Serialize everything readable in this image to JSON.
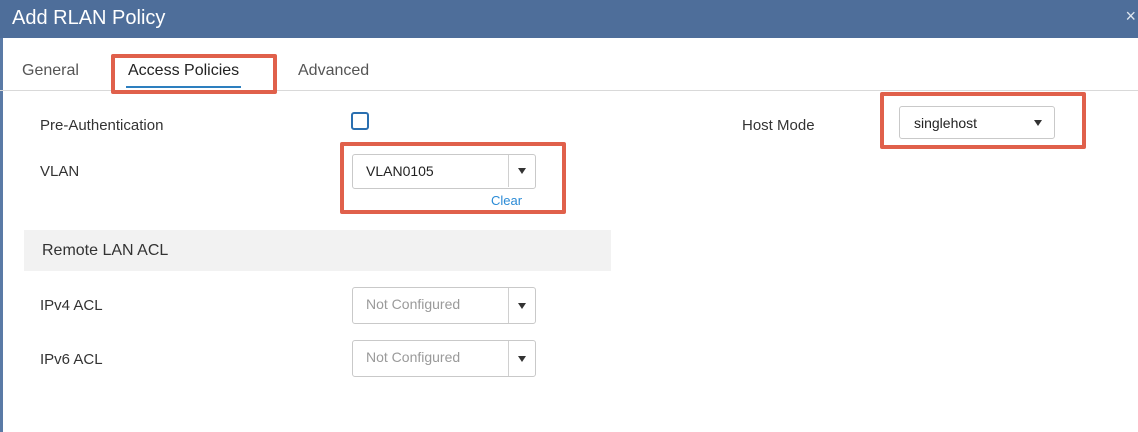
{
  "dialog": {
    "title": "Add RLAN Policy",
    "close_glyph": "×"
  },
  "tabs": [
    {
      "label": "General"
    },
    {
      "label": "Access Policies",
      "active": true
    },
    {
      "label": "Advanced"
    }
  ],
  "form": {
    "pre_authentication": {
      "label": "Pre-Authentication",
      "checked": false
    },
    "vlan": {
      "label": "VLAN",
      "value": "VLAN0105",
      "clear_label": "Clear"
    },
    "host_mode": {
      "label": "Host Mode",
      "value": "singlehost"
    },
    "remote_lan_acl": {
      "title": "Remote LAN ACL",
      "ipv4": {
        "label": "IPv4 ACL",
        "value": "Not Configured"
      },
      "ipv6": {
        "label": "IPv6 ACL",
        "value": "Not Configured"
      }
    }
  },
  "colors": {
    "titlebar": "#4e6e9a",
    "highlight": "#e0604b",
    "active_tab_underline": "#2d7fbf",
    "link": "#2b8bd6"
  },
  "icons": {
    "close": "close-icon",
    "dropdown": "chevron-down-icon",
    "checkbox": "checkbox-icon"
  }
}
